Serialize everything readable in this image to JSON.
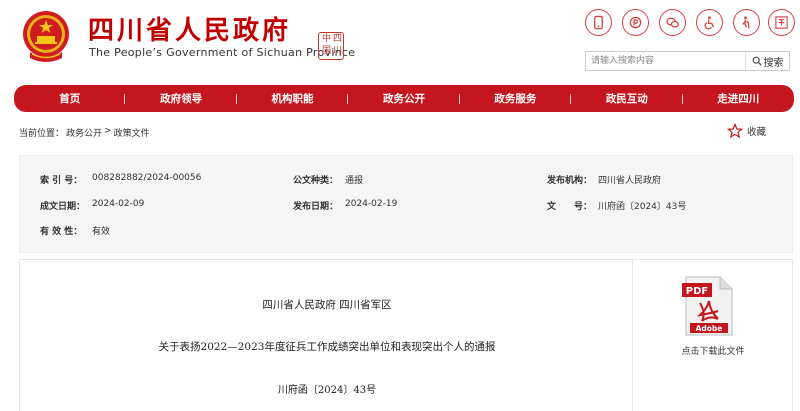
{
  "header": {
    "title_cn": "四川省人民政府",
    "title_en": "The People’s Government of Sichuan Province",
    "seal_chars": [
      "四",
      "川",
      "中",
      "国"
    ],
    "brand_color": "#c00000",
    "tool_icons": [
      "mobile-icon",
      "weibo-icon",
      "wechat-icon",
      "accessibility-icon",
      "elderly-icon",
      "language-icon"
    ]
  },
  "search": {
    "placeholder": "请输入搜索内容",
    "button_label": "搜索"
  },
  "nav": {
    "accent": "#c4161c",
    "items": [
      {
        "label": "首页"
      },
      {
        "label": "政府领导"
      },
      {
        "label": "机构职能"
      },
      {
        "label": "政务公开"
      },
      {
        "label": "政务服务"
      },
      {
        "label": "政民互动"
      },
      {
        "label": "走进四川"
      }
    ]
  },
  "breadcrumb": {
    "prefix": "当前位置：",
    "items": [
      "政务公开",
      "政策文件"
    ],
    "separator": ">"
  },
  "favorite": {
    "label": "收藏"
  },
  "meta": {
    "index_label": "索 引 号：",
    "index_value": "008282882/2024-00056",
    "type_label": "公文种类：",
    "type_value": "通报",
    "issuer_label": "发布机构：",
    "issuer_value": "四川省人民政府",
    "created_label": "成文日期：",
    "created_value": "2024-02-09",
    "published_label": "发布日期：",
    "published_value": "2024-02-19",
    "doc_no_label": "文　　号：",
    "doc_no_value": "川府函〔2024〕43号",
    "validity_label": "有 效 性：",
    "validity_value": "有效"
  },
  "document": {
    "issuer": "四川省人民政府  四川省军区",
    "title": "关于表扬2022—2023年度征兵工作成绩突出单位和表现突出个人的通报",
    "number": "川府函〔2024〕43号"
  },
  "sidebar": {
    "download_label": "点击下载此文件",
    "pdf_label": "PDF",
    "pdf_brand": "Adobe"
  }
}
